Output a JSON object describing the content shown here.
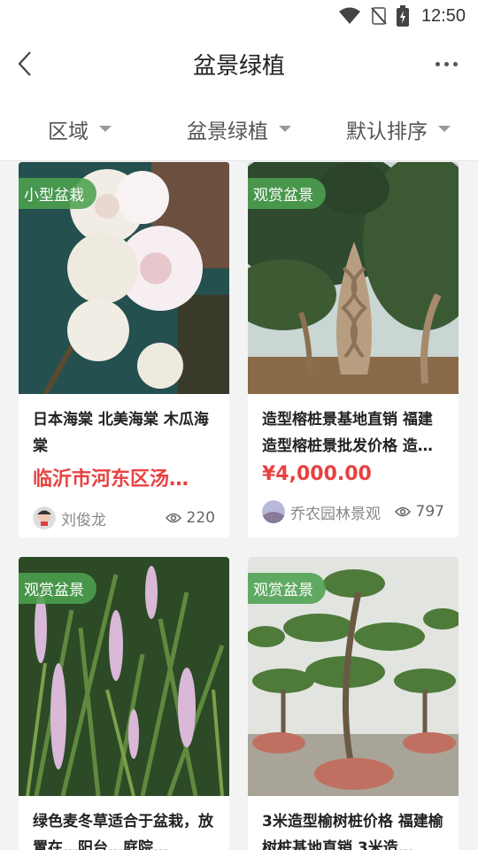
{
  "status": {
    "time": "12:50"
  },
  "header": {
    "title": "盆景绿植"
  },
  "filters": [
    {
      "label": "区域"
    },
    {
      "label": "盆景绿植"
    },
    {
      "label": "默认排序"
    }
  ],
  "cards": [
    {
      "tag": "小型盆栽",
      "title": "日本海棠 北美海棠 木瓜海棠",
      "price": "临沂市河东区汤…",
      "author": "刘俊龙",
      "views": "220"
    },
    {
      "tag": "观赏盆景",
      "title": "造型榕桩景基地直销 福建造型榕桩景批发价格 造…",
      "price": "¥4,000.00",
      "author": "乔农园林景观",
      "views": "797"
    },
    {
      "tag": "观赏盆景",
      "title": "绿色麦冬草适合于盆栽，放置在…阳台…庭院…",
      "price": "",
      "author": "",
      "views": ""
    },
    {
      "tag": "观赏盆景",
      "title": "3米造型榆树桩价格 福建榆树桩基地直销 3米造…",
      "price": "",
      "author": "",
      "views": ""
    }
  ],
  "icons": {
    "back": "chevron-left-icon",
    "more": "more-dots-icon",
    "wifi": "wifi-icon",
    "signal": "no-signal-icon",
    "battery": "battery-charging-icon",
    "views": "eye-icon"
  },
  "colors": {
    "price": "#e8413f",
    "tag": "#4ca050"
  }
}
